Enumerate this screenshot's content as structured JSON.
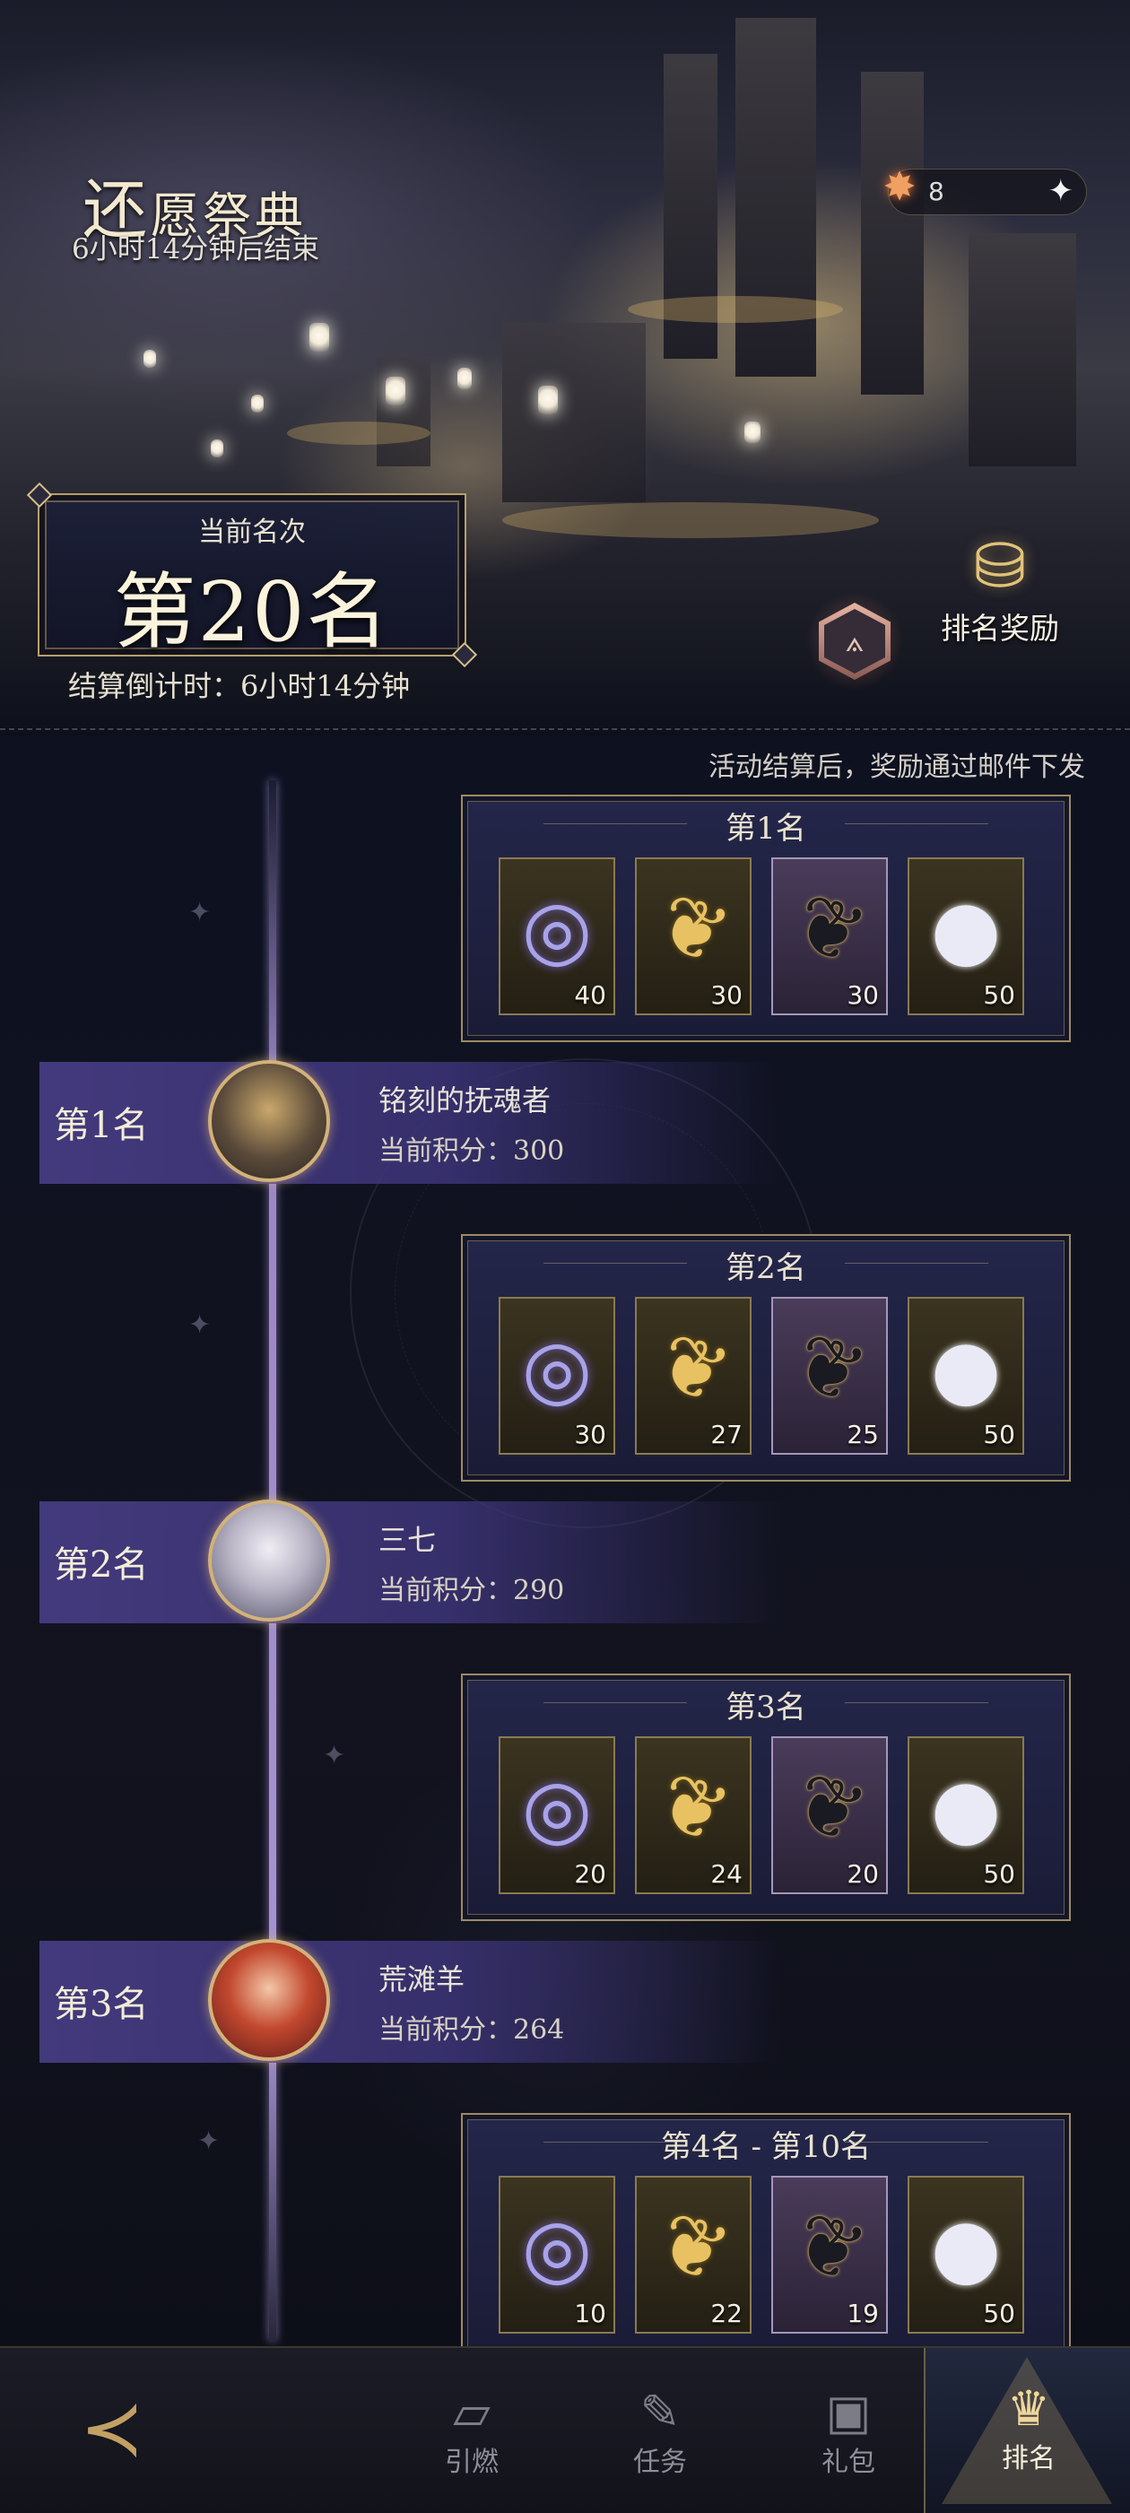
{
  "header": {
    "title_first": "还",
    "title_rest": "愿祭典",
    "subtitle": "6小时14分钟后结束",
    "currency": {
      "icon": "star-burst-icon",
      "value": "8",
      "plus_icon": "sparkle-plus-icon"
    }
  },
  "rank_panel": {
    "label": "当前名次",
    "value": "第20名",
    "countdown": "结算倒计时：6小时14分钟"
  },
  "reward_button": {
    "label": "排名奖励",
    "icon": "treasure-chest-icon"
  },
  "note": "活动结算后，奖励通过邮件下发",
  "reward_cards": [
    {
      "title": "第1名",
      "items": [
        {
          "icon": "crystal-ring-icon",
          "qty": "40"
        },
        {
          "icon": "golden-feather-icon",
          "qty": "30"
        },
        {
          "icon": "dark-feather-icon",
          "qty": "30"
        },
        {
          "icon": "crystal-orb-icon",
          "qty": "50"
        }
      ]
    },
    {
      "title": "第2名",
      "items": [
        {
          "icon": "crystal-ring-icon",
          "qty": "30"
        },
        {
          "icon": "golden-feather-icon",
          "qty": "27"
        },
        {
          "icon": "dark-feather-icon",
          "qty": "25"
        },
        {
          "icon": "crystal-orb-icon",
          "qty": "50"
        }
      ]
    },
    {
      "title": "第3名",
      "items": [
        {
          "icon": "crystal-ring-icon",
          "qty": "20"
        },
        {
          "icon": "golden-feather-icon",
          "qty": "24"
        },
        {
          "icon": "dark-feather-icon",
          "qty": "20"
        },
        {
          "icon": "crystal-orb-icon",
          "qty": "50"
        }
      ]
    },
    {
      "title": "第4名 - 第10名",
      "items": [
        {
          "icon": "crystal-ring-icon",
          "qty": "10"
        },
        {
          "icon": "golden-feather-icon",
          "qty": "22"
        },
        {
          "icon": "dark-feather-icon",
          "qty": "19"
        },
        {
          "icon": "crystal-orb-icon",
          "qty": "50"
        }
      ]
    }
  ],
  "players": [
    {
      "rank": "第1名",
      "name": "铭刻的抚魂者",
      "score": "当前积分：300"
    },
    {
      "rank": "第2名",
      "name": "三七",
      "score": "当前积分：290"
    },
    {
      "rank": "第3名",
      "name": "荒滩羊",
      "score": "当前积分：264"
    }
  ],
  "nav": {
    "items": [
      {
        "label": "引燃",
        "icon": "cards-icon"
      },
      {
        "label": "任务",
        "icon": "quill-icon"
      },
      {
        "label": "礼包",
        "icon": "gift-icon"
      },
      {
        "label": "排名",
        "icon": "trophy-icon"
      }
    ]
  },
  "colors": {
    "gold": "#c9a964",
    "panel": "#1e2040",
    "accent_purple": "#5a4c9a"
  }
}
